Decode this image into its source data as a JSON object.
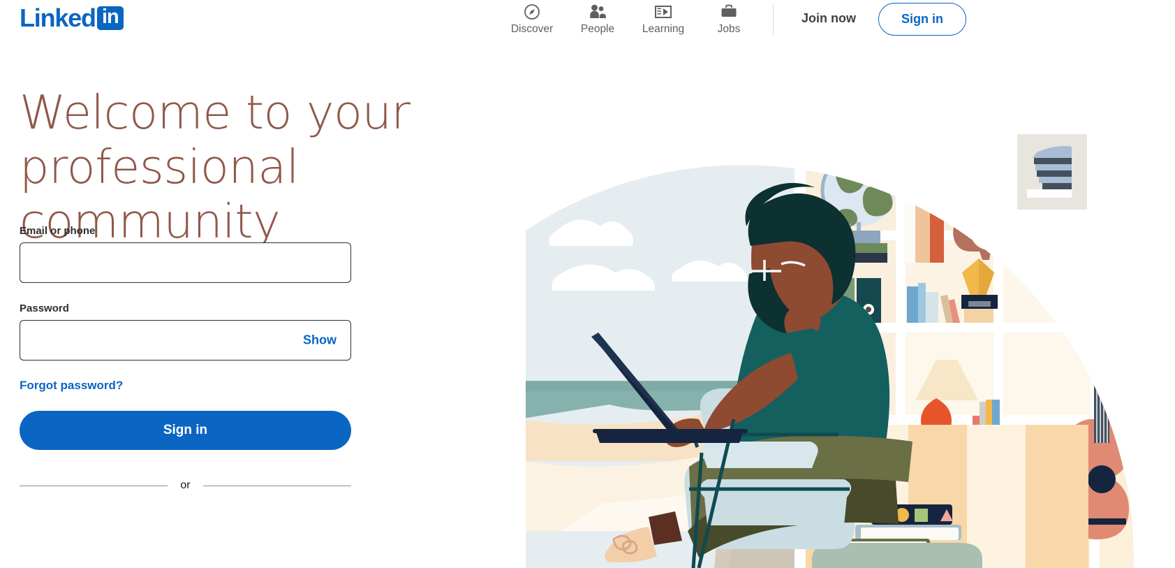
{
  "brand": {
    "logo_word": "Linked",
    "logo_box": "in",
    "accent_blue": "#0a66c2",
    "headline_color": "#8f5849"
  },
  "header": {
    "nav": [
      {
        "label": "Discover",
        "icon": "compass-icon"
      },
      {
        "label": "People",
        "icon": "people-icon"
      },
      {
        "label": "Learning",
        "icon": "learning-play-icon"
      },
      {
        "label": "Jobs",
        "icon": "briefcase-icon"
      }
    ],
    "join_now_label": "Join now",
    "sign_in_label": "Sign in"
  },
  "hero": {
    "headline_line1": "Welcome to your",
    "headline_line2": "professional community"
  },
  "form": {
    "email_label": "Email or phone",
    "email_value": "",
    "email_placeholder": "",
    "password_label": "Password",
    "password_value": "",
    "password_placeholder": "",
    "show_label": "Show",
    "forgot_label": "Forgot password?",
    "submit_label": "Sign in",
    "divider_label": "or"
  },
  "illustration": {
    "description": "Person with glasses and beard seated in an armchair using a laptop, in front of a bookshelf",
    "colors": {
      "sky": "#e6edf0",
      "cloud": "#ffffff",
      "sea": "#86b2ae",
      "sand": "#d4cbbd",
      "shelf_bg": "#faeedd",
      "shelf_bg_alt": "#fdf6ec",
      "skin": "#8f4a32",
      "hair": "#0d3030",
      "shirt": "#14605f",
      "pants": "#6a6f45",
      "pants_dark": "#474a2b",
      "chair": "#c9dde3",
      "chair_frame": "#0f4a4f",
      "guitar": "#e08a74",
      "cat": "#b5705e",
      "lamp_base": "#e8542a",
      "trophy": "#f0b94a",
      "globe_land": "#6f8a5a",
      "shoe": "#f2cfa8",
      "book_green": "#6d8e72",
      "book_blue": "#6fa8cf",
      "frame_bg": "#e7e5dd",
      "frame_art": "#a8bcd4"
    }
  }
}
